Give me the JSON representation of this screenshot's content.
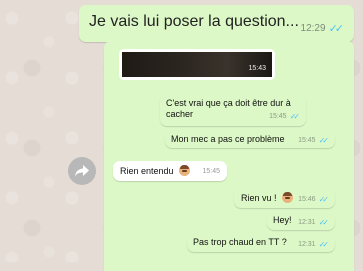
{
  "messages": {
    "top": {
      "text": "Je vais lui poser la question...",
      "time": "12:29"
    },
    "media": {
      "time": "15:43"
    },
    "m1": {
      "text": "C'est vrai que ça doit être dur à cacher",
      "time": "15:45"
    },
    "m2": {
      "text": "Mon mec a pas ce problème",
      "time": "15:45"
    },
    "m3": {
      "text": "Rien entendu",
      "time": "15:45"
    },
    "m4": {
      "text": "Rien vu !",
      "time": "15:46"
    },
    "m5": {
      "text": "Hey!",
      "time": "12:31"
    },
    "m6": {
      "text": "Pas trop chaud en TT ?",
      "time": "12:31"
    }
  },
  "icons": {
    "forward": "forward-arrow-icon",
    "read_receipt": "double-check-icon",
    "emoji": "see-no-evil-monkey-icon"
  },
  "colors": {
    "outgoing_bubble": "#dcf8c6",
    "incoming_bubble": "#ffffff",
    "read_ticks": "#4fc3f7",
    "background": "#e5ddd5"
  }
}
